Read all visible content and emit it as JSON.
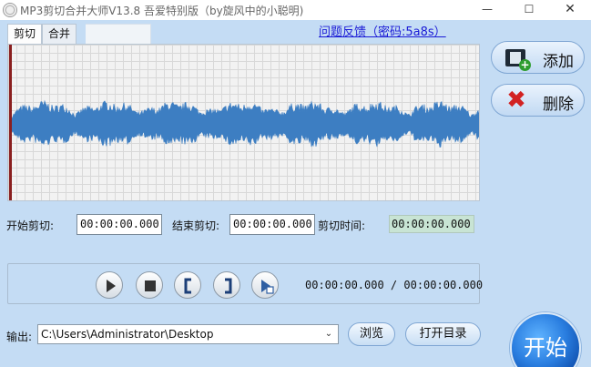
{
  "window": {
    "title": "MP3剪切合并大师V13.8 吾爱特别版（by旋风中的小聪明)",
    "minimize_glyph": "—",
    "maximize_glyph": "☐",
    "close_glyph": "✕"
  },
  "tabs": [
    {
      "label": "剪切",
      "active": true
    },
    {
      "label": "合并",
      "active": false
    }
  ],
  "feedback_link": "问题反馈（密码:5a8s）",
  "side_buttons": {
    "add_label": "添加",
    "delete_label": "删除"
  },
  "cut_fields": {
    "start_label": "开始剪切:",
    "start_value": "00:00:00.000",
    "end_label": "结束剪切:",
    "end_value": "00:00:00.000",
    "duration_label": "剪切时间:",
    "duration_value": "00:00:00.000"
  },
  "player": {
    "buttons": [
      "play-icon",
      "stop-icon",
      "mark-start-icon",
      "mark-end-icon",
      "play-selection-icon"
    ],
    "position": "00:00:00.000 / 00:00:00.000"
  },
  "output": {
    "label": "输出:",
    "path": "C:\\Users\\Administrator\\Desktop",
    "browse_label": "浏览",
    "open_dir_label": "打开目录"
  },
  "start_button_label": "开始",
  "colors": {
    "background": "#c4dcf4",
    "waveform": "#3d7ec2",
    "marker": "#8a1f1f",
    "link": "#1a1ad6",
    "start_button": "#2a7ee0"
  }
}
